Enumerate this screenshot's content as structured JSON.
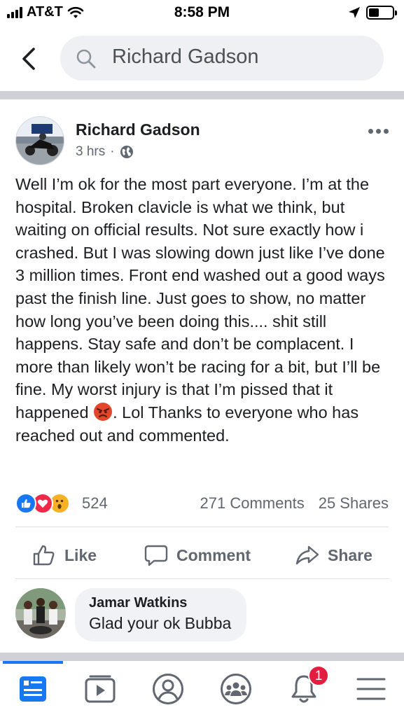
{
  "status_bar": {
    "carrier": "AT&T",
    "time": "8:58 PM"
  },
  "search": {
    "query": "Richard Gadson"
  },
  "post": {
    "author": "Richard Gadson",
    "time": "3 hrs",
    "separator": "·",
    "text_part1": "Well I’m ok for the most part everyone. I’m at the hospital. Broken clavicle is what we think, but waiting on official results. Not sure exactly how i crashed. But I was slowing down just like I’ve done 3 million times. Front end washed out a good ways past the finish line. Just goes to show, no matter how long you’ve been doing this.... shit still happens. Stay safe and don’t be complacent. I more than likely won’t be racing for a bit, but I’ll be fine. My worst injury is that I’m pissed that it happened ",
    "text_part2": ". Lol Thanks to everyone who has reached out and commented.",
    "reaction_count": "524",
    "comments": "271 Comments",
    "shares": "25 Shares"
  },
  "actions": {
    "like": "Like",
    "comment": "Comment",
    "share": "Share"
  },
  "comment": {
    "name": "Jamar Watkins",
    "text": "Glad your ok Bubba"
  },
  "tabbar": {
    "notifications_badge": "1"
  },
  "colors": {
    "brand": "#1877f2",
    "badge": "#e41e3f",
    "text_secondary": "#606770"
  }
}
